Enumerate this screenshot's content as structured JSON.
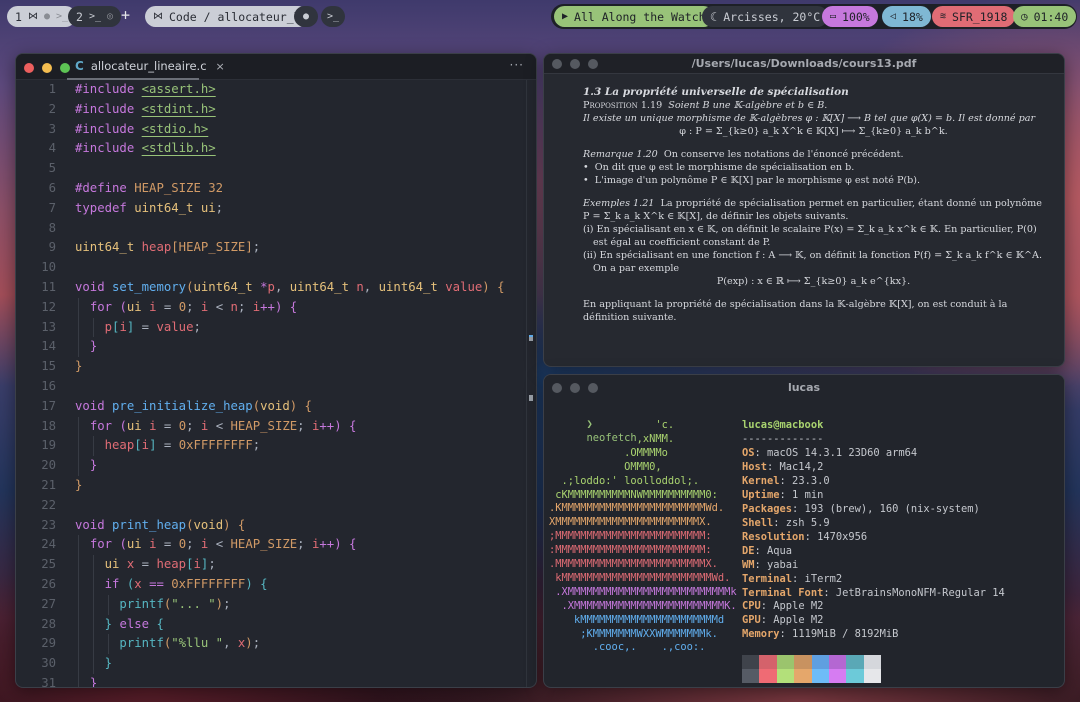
{
  "topbar": {
    "workspaces": [
      {
        "index": "1",
        "icons": [
          "vscode-icon",
          "ollama-icon",
          "terminal-icon"
        ],
        "active": true
      },
      {
        "index": "2",
        "icons": [
          "terminal-icon",
          "chrome-icon"
        ],
        "active": false
      }
    ],
    "add_label": "+",
    "focused_app": {
      "icon": "vscode-icon",
      "label": "Code / allocateur_l"
    },
    "extra_apps": [
      "ollama-icon",
      "terminal-icon"
    ],
    "now_playing": {
      "icon": "play-icon",
      "label": "All Along the Watch"
    },
    "weather": {
      "icon": "moon-icon",
      "label": "Arcisses, 20°C"
    },
    "battery": {
      "icon": "battery-icon",
      "label": "100%"
    },
    "volume": {
      "icon": "speaker-icon",
      "label": "18%"
    },
    "wifi": {
      "icon": "wifi-icon",
      "label": "SFR_1918"
    },
    "clock": {
      "icon": "clock-icon",
      "label": "01:40"
    },
    "colors": {
      "green": "#98c379",
      "purple": "#c678dd",
      "blue": "#7fb8d4",
      "red": "#e06c75"
    }
  },
  "editor": {
    "tab": {
      "icon": "c-language-icon",
      "icon_glyph": "C",
      "label": "allocateur_lineaire.c",
      "close": "×"
    },
    "more": "···",
    "lines": [
      {
        "n": "1",
        "tokens": [
          [
            "kw",
            "#include "
          ],
          [
            "inc",
            "<assert.h>"
          ]
        ]
      },
      {
        "n": "2",
        "tokens": [
          [
            "kw",
            "#include "
          ],
          [
            "inc",
            "<stdint.h>"
          ]
        ]
      },
      {
        "n": "3",
        "tokens": [
          [
            "kw",
            "#include "
          ],
          [
            "inc",
            "<stdio.h>"
          ]
        ]
      },
      {
        "n": "4",
        "tokens": [
          [
            "kw",
            "#include "
          ],
          [
            "inc",
            "<stdlib.h>"
          ]
        ]
      },
      {
        "n": "5",
        "tokens": []
      },
      {
        "n": "6",
        "tokens": [
          [
            "kw",
            "#define "
          ],
          [
            "mac",
            "HEAP_SIZE 32"
          ]
        ]
      },
      {
        "n": "7",
        "tokens": [
          [
            "kw",
            "typedef "
          ],
          [
            "ty",
            "uint64_t ui"
          ],
          [
            "pun",
            ";"
          ]
        ]
      },
      {
        "n": "8",
        "tokens": []
      },
      {
        "n": "9",
        "tokens": [
          [
            "ty",
            "uint64_t "
          ],
          [
            "var",
            "heap"
          ],
          [
            "b1",
            "["
          ],
          [
            "mac",
            "HEAP_SIZE"
          ],
          [
            "b1",
            "]"
          ],
          [
            "pun",
            ";"
          ]
        ]
      },
      {
        "n": "10",
        "tokens": []
      },
      {
        "n": "11",
        "tokens": [
          [
            "kw",
            "void "
          ],
          [
            "fn",
            "set_memory"
          ],
          [
            "b1",
            "("
          ],
          [
            "ty",
            "uint64_t "
          ],
          [
            "op",
            "*"
          ],
          [
            "var",
            "p"
          ],
          [
            "pun",
            ", "
          ],
          [
            "ty",
            "uint64_t "
          ],
          [
            "var",
            "n"
          ],
          [
            "pun",
            ", "
          ],
          [
            "ty",
            "uint64_t "
          ],
          [
            "var",
            "value"
          ],
          [
            "b1",
            ")"
          ],
          [
            "pun",
            " "
          ],
          [
            "b1",
            "{"
          ]
        ]
      },
      {
        "n": "12",
        "tokens": [
          [
            "pun",
            "  "
          ],
          [
            "kw",
            "for "
          ],
          [
            "b2",
            "("
          ],
          [
            "ty",
            "ui "
          ],
          [
            "var",
            "i"
          ],
          [
            "pun",
            " = "
          ],
          [
            "num",
            "0"
          ],
          [
            "pun",
            "; "
          ],
          [
            "var",
            "i"
          ],
          [
            "pun",
            " < "
          ],
          [
            "var",
            "n"
          ],
          [
            "pun",
            "; "
          ],
          [
            "var",
            "i"
          ],
          [
            "op",
            "++"
          ],
          [
            "b2",
            ")"
          ],
          [
            "pun",
            " "
          ],
          [
            "b2",
            "{"
          ]
        ]
      },
      {
        "n": "13",
        "tokens": [
          [
            "pun",
            "    "
          ],
          [
            "var",
            "p"
          ],
          [
            "b3",
            "["
          ],
          [
            "var",
            "i"
          ],
          [
            "b3",
            "]"
          ],
          [
            "pun",
            " = "
          ],
          [
            "var",
            "value"
          ],
          [
            "pun",
            ";"
          ]
        ]
      },
      {
        "n": "14",
        "tokens": [
          [
            "pun",
            "  "
          ],
          [
            "b2",
            "}"
          ]
        ]
      },
      {
        "n": "15",
        "tokens": [
          [
            "b1",
            "}"
          ]
        ]
      },
      {
        "n": "16",
        "tokens": []
      },
      {
        "n": "17",
        "tokens": [
          [
            "kw",
            "void "
          ],
          [
            "fn",
            "pre_initialize_heap"
          ],
          [
            "b1",
            "("
          ],
          [
            "ty",
            "void"
          ],
          [
            "b1",
            ")"
          ],
          [
            "pun",
            " "
          ],
          [
            "b1",
            "{"
          ]
        ]
      },
      {
        "n": "18",
        "tokens": [
          [
            "pun",
            "  "
          ],
          [
            "kw",
            "for "
          ],
          [
            "b2",
            "("
          ],
          [
            "ty",
            "ui "
          ],
          [
            "var",
            "i"
          ],
          [
            "pun",
            " = "
          ],
          [
            "num",
            "0"
          ],
          [
            "pun",
            "; "
          ],
          [
            "var",
            "i"
          ],
          [
            "pun",
            " < "
          ],
          [
            "mac",
            "HEAP_SIZE"
          ],
          [
            "pun",
            "; "
          ],
          [
            "var",
            "i"
          ],
          [
            "op",
            "++"
          ],
          [
            "b2",
            ")"
          ],
          [
            "pun",
            " "
          ],
          [
            "b2",
            "{"
          ]
        ]
      },
      {
        "n": "19",
        "tokens": [
          [
            "pun",
            "    "
          ],
          [
            "var",
            "heap"
          ],
          [
            "b3",
            "["
          ],
          [
            "var",
            "i"
          ],
          [
            "b3",
            "]"
          ],
          [
            "pun",
            " = "
          ],
          [
            "num",
            "0xFFFFFFFF"
          ],
          [
            "pun",
            ";"
          ]
        ]
      },
      {
        "n": "20",
        "tokens": [
          [
            "pun",
            "  "
          ],
          [
            "b2",
            "}"
          ]
        ]
      },
      {
        "n": "21",
        "tokens": [
          [
            "b1",
            "}"
          ]
        ]
      },
      {
        "n": "22",
        "tokens": []
      },
      {
        "n": "23",
        "tokens": [
          [
            "kw",
            "void "
          ],
          [
            "fn",
            "print_heap"
          ],
          [
            "b1",
            "("
          ],
          [
            "ty",
            "void"
          ],
          [
            "b1",
            ")"
          ],
          [
            "pun",
            " "
          ],
          [
            "b1",
            "{"
          ]
        ]
      },
      {
        "n": "24",
        "tokens": [
          [
            "pun",
            "  "
          ],
          [
            "kw",
            "for "
          ],
          [
            "b2",
            "("
          ],
          [
            "ty",
            "ui "
          ],
          [
            "var",
            "i"
          ],
          [
            "pun",
            " = "
          ],
          [
            "num",
            "0"
          ],
          [
            "pun",
            "; "
          ],
          [
            "var",
            "i"
          ],
          [
            "pun",
            " < "
          ],
          [
            "mac",
            "HEAP_SIZE"
          ],
          [
            "pun",
            "; "
          ],
          [
            "var",
            "i"
          ],
          [
            "op",
            "++"
          ],
          [
            "b2",
            ")"
          ],
          [
            "pun",
            " "
          ],
          [
            "b2",
            "{"
          ]
        ]
      },
      {
        "n": "25",
        "tokens": [
          [
            "pun",
            "    "
          ],
          [
            "ty",
            "ui "
          ],
          [
            "var",
            "x"
          ],
          [
            "pun",
            " = "
          ],
          [
            "var",
            "heap"
          ],
          [
            "b3",
            "["
          ],
          [
            "var",
            "i"
          ],
          [
            "b3",
            "]"
          ],
          [
            "pun",
            ";"
          ]
        ]
      },
      {
        "n": "26",
        "tokens": [
          [
            "pun",
            "    "
          ],
          [
            "kw",
            "if "
          ],
          [
            "b3",
            "("
          ],
          [
            "var",
            "x"
          ],
          [
            "pun",
            " "
          ],
          [
            "op",
            "=="
          ],
          [
            "pun",
            " "
          ],
          [
            "num",
            "0xFFFFFFFF"
          ],
          [
            "b3",
            ")"
          ],
          [
            "pun",
            " "
          ],
          [
            "b3",
            "{"
          ]
        ]
      },
      {
        "n": "27",
        "tokens": [
          [
            "pun",
            "      "
          ],
          [
            "call",
            "printf"
          ],
          [
            "b1",
            "("
          ],
          [
            "str",
            "\"... \""
          ],
          [
            "b1",
            ")"
          ],
          [
            "pun",
            ";"
          ]
        ]
      },
      {
        "n": "28",
        "tokens": [
          [
            "pun",
            "    "
          ],
          [
            "b3",
            "}"
          ],
          [
            "pun",
            " "
          ],
          [
            "kw",
            "else "
          ],
          [
            "b3",
            "{"
          ]
        ]
      },
      {
        "n": "29",
        "tokens": [
          [
            "pun",
            "      "
          ],
          [
            "call",
            "printf"
          ],
          [
            "b1",
            "("
          ],
          [
            "str",
            "\"%llu \""
          ],
          [
            "pun",
            ", "
          ],
          [
            "var",
            "x"
          ],
          [
            "b1",
            ")"
          ],
          [
            "pun",
            ";"
          ]
        ]
      },
      {
        "n": "30",
        "tokens": [
          [
            "pun",
            "    "
          ],
          [
            "b3",
            "}"
          ]
        ]
      },
      {
        "n": "31",
        "tokens": [
          [
            "pun",
            "  "
          ],
          [
            "b2",
            "}"
          ]
        ]
      }
    ]
  },
  "pdf": {
    "title": "/Users/lucas/Downloads/cours13.pdf",
    "section": "1.3  La propriété universelle de spécialisation",
    "prop_label": "Proposition 1.19",
    "prop_line1": "Soient B une 𝕂-algèbre et b ∈ B.",
    "prop_line2": "Il existe un unique morphisme de 𝕂-algèbres φ : 𝕂[X] ⟶ B tel que φ(X) = b. Il est donné par",
    "prop_formula": "φ : P = Σ_{k≥0} a_k X^k ∈ 𝕂[X] ⟼ Σ_{k≥0} a_k b^k.",
    "remark_label": "Remarque 1.20",
    "remark_text": "On conserve les notations de l'énoncé précédent.",
    "remark_bullets": [
      "On dit que φ est le morphisme de spécialisation en b.",
      "L'image d'un polynôme P ∈ 𝕂[X] par le morphisme φ est noté P(b)."
    ],
    "examples_label": "Exemples 1.21",
    "examples_text": "La propriété de spécialisation permet en particulier, étant donné un polynôme P = Σ_k a_k X^k ∈ 𝕂[X], de définir les objets suivants.",
    "examples_items": [
      "(i)  En spécialisant en x ∈ 𝕂, on définit le scalaire P(x) = Σ_k a_k x^k ∈ 𝕂. En particulier, P(0) est égal au coefficient constant de P.",
      "(ii)  En spécialisant en une fonction f : A ⟶ 𝕂, on définit la fonction P(f) = Σ_k a_k f^k ∈ 𝕂^A. On a par exemple"
    ],
    "examples_formula": "P(exp) : x ∈ ℝ ⟼ Σ_{k≥0} a_k e^{kx}.",
    "conclusion": "En appliquant la propriété de spécialisation dans la 𝕂-algèbre 𝕂[X], on est conduit à la définition suivante."
  },
  "terminal": {
    "title": "lucas",
    "prompt_symbol": "❯",
    "command": "neofetch",
    "ascii": [
      {
        "c": "g",
        "t": "                 'c."
      },
      {
        "c": "g",
        "t": "              ,xNMM."
      },
      {
        "c": "g",
        "t": "            .OMMMMo"
      },
      {
        "c": "g",
        "t": "            OMMM0,"
      },
      {
        "c": "g",
        "t": "  .;loddo:' loolloddol;."
      },
      {
        "c": "g",
        "t": " cKMMMMMMMMMMNWMMMMMMMMMM0:"
      },
      {
        "c": "o",
        "t": ".KMMMMMMMMMMMMMMMMMMMMMMMWd."
      },
      {
        "c": "o",
        "t": "XMMMMMMMMMMMMMMMMMMMMMMMX."
      },
      {
        "c": "r",
        "t": ";MMMMMMMMMMMMMMMMMMMMMMMM:"
      },
      {
        "c": "r",
        "t": ":MMMMMMMMMMMMMMMMMMMMMMMM:"
      },
      {
        "c": "r",
        "t": ".MMMMMMMMMMMMMMMMMMMMMMMMX."
      },
      {
        "c": "r",
        "t": " kMMMMMMMMMMMMMMMMMMMMMMMMWd."
      },
      {
        "c": "p",
        "t": " .XMMMMMMMMMMMMMMMMMMMMMMMMMMk"
      },
      {
        "c": "p",
        "t": "  .XMMMMMMMMMMMMMMMMMMMMMMMMK."
      },
      {
        "c": "b",
        "t": "    kMMMMMMMMMMMMMMMMMMMMMMd"
      },
      {
        "c": "b",
        "t": "     ;KMMMMMMMWXXWMMMMMMMk."
      },
      {
        "c": "b",
        "t": "       .cooc,.    .,coo:."
      }
    ],
    "user_host": "lucas@macbook",
    "separator": "-------------",
    "info": [
      {
        "label": "OS",
        "value": "macOS 14.3.1 23D60 arm64"
      },
      {
        "label": "Host",
        "value": "Mac14,2"
      },
      {
        "label": "Kernel",
        "value": "23.3.0"
      },
      {
        "label": "Uptime",
        "value": "1 min"
      },
      {
        "label": "Packages",
        "value": "193 (brew), 160 (nix-system)"
      },
      {
        "label": "Shell",
        "value": "zsh 5.9"
      },
      {
        "label": "Resolution",
        "value": "1470x956"
      },
      {
        "label": "DE",
        "value": "Aqua"
      },
      {
        "label": "WM",
        "value": "yabai"
      },
      {
        "label": "Terminal",
        "value": "iTerm2"
      },
      {
        "label": "Terminal Font",
        "value": "JetBrainsMonoNFM-Regular 14"
      },
      {
        "label": "CPU",
        "value": "Apple M2"
      },
      {
        "label": "GPU",
        "value": "Apple M2"
      },
      {
        "label": "Memory",
        "value": "1119MiB / 8192MiB"
      }
    ],
    "palette_row1": [
      "#3f434b",
      "#d4626b",
      "#9bc46d",
      "#c89260",
      "#5f9fe0",
      "#b467d2",
      "#5aa8b6",
      "#d5d7dc"
    ],
    "palette_row2": [
      "#565b65",
      "#ef6b74",
      "#b3e07a",
      "#e5a76b",
      "#6ebcf7",
      "#d67cf2",
      "#6ccad9",
      "#e6e7ea"
    ]
  }
}
